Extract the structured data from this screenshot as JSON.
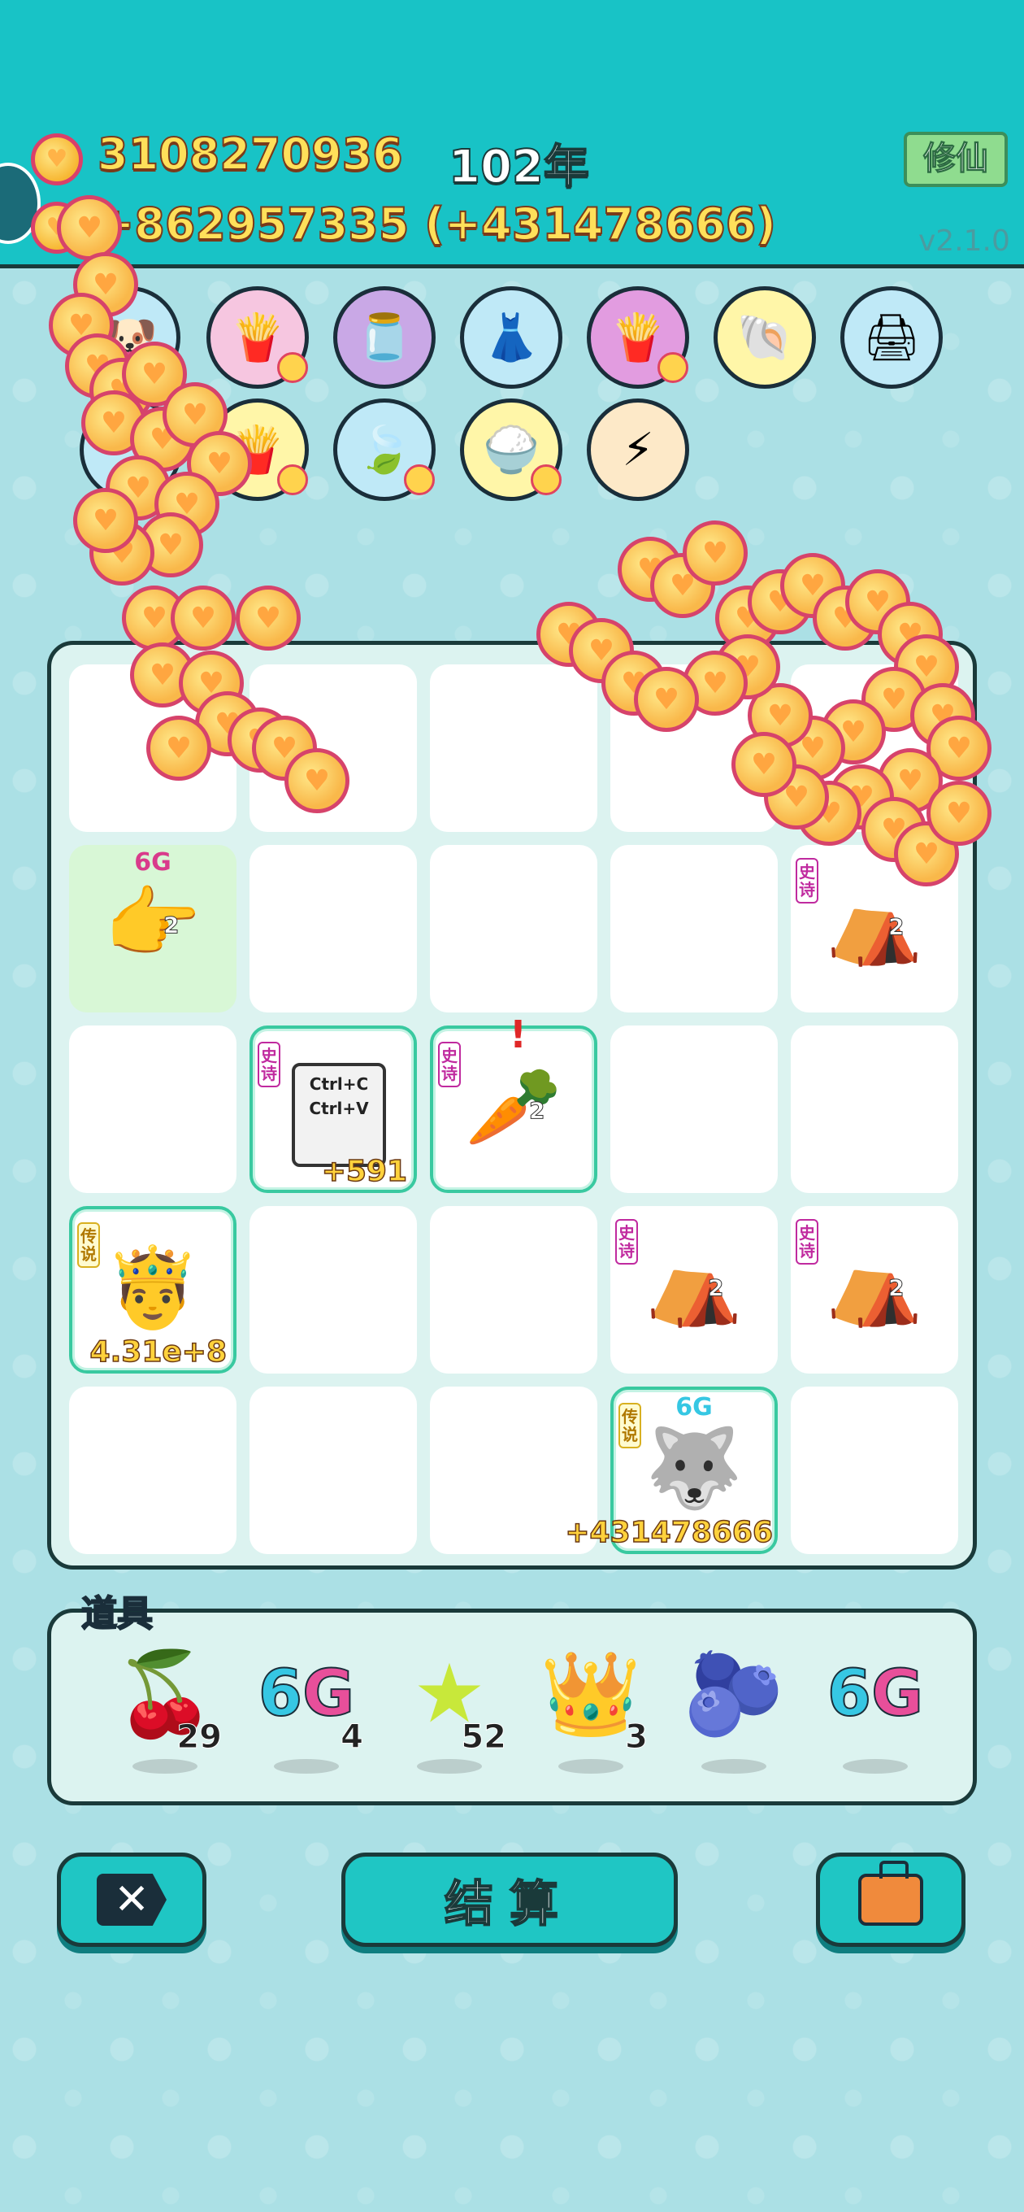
{
  "header": {
    "coins_total": "3108270936",
    "coins_rate": "+862957335 (+431478666)",
    "year": "102年",
    "xiuxian_label": "修仙",
    "version": "v2.1.0"
  },
  "item_row": [
    {
      "name": "fries-icon"
    },
    {
      "name": "jar-icon"
    },
    {
      "name": "skirt-icon"
    },
    {
      "name": "fries-icon"
    },
    {
      "name": "shell-icon"
    },
    {
      "name": "printer-icon"
    }
  ],
  "board": {
    "cells": [
      {
        "top": "6G"
      },
      {
        "tag": "史诗"
      },
      {
        "tag": "史诗",
        "value": "+591",
        "card_line1": "Ctrl+C",
        "card_line2": "Ctrl+V"
      },
      {
        "tag": "史诗",
        "badge": "!"
      },
      {
        "tag": "传说",
        "value": "4.31e+8"
      },
      {
        "tag": "史诗"
      },
      {
        "tag": "史诗"
      },
      {
        "tag": "传说",
        "top": "6G",
        "value": "+431478666"
      }
    ],
    "mini_counts": [
      "2",
      "2",
      "2",
      "2",
      "2"
    ]
  },
  "tools": {
    "title": "道具",
    "items": [
      {
        "name": "lychee",
        "count": "29"
      },
      {
        "name": "6g",
        "count": "4",
        "six": "6",
        "g": "G"
      },
      {
        "name": "star",
        "count": "52"
      },
      {
        "name": "crown",
        "count": "3"
      },
      {
        "name": "blueberry",
        "count": ""
      },
      {
        "name": "6g",
        "count": "",
        "six": "6",
        "g": "G"
      }
    ]
  },
  "buttons": {
    "close_label": "✕",
    "settle_label": "结算"
  }
}
